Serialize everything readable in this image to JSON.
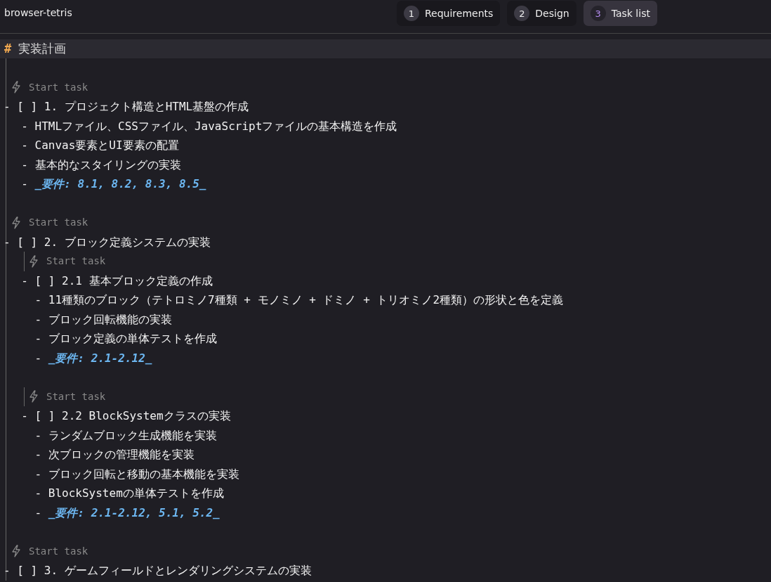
{
  "window": {
    "title": "browser-tetris"
  },
  "tabs": [
    {
      "number": "1",
      "label": "Requirements",
      "selected": false
    },
    {
      "number": "2",
      "label": "Design",
      "selected": false
    },
    {
      "number": "3",
      "label": "Task list",
      "selected": true
    }
  ],
  "heading": {
    "marker": "#",
    "text": "実装計画"
  },
  "lines": [
    {
      "kind": "blank"
    },
    {
      "kind": "codelens",
      "text": "Start task"
    },
    {
      "kind": "task",
      "text": "- [ ] 1. プロジェクト構造とHTML基盤の作成"
    },
    {
      "kind": "line",
      "text": "  - HTMLファイル、CSSファイル、JavaScriptファイルの基本構造を作成"
    },
    {
      "kind": "line",
      "text": "  - Canvas要素とUI要素の配置"
    },
    {
      "kind": "line",
      "text": "  - 基本的なスタイリングの実装"
    },
    {
      "kind": "requirement",
      "bullet": "  - ",
      "text": "_要件: 8.1, 8.2, 8.3, 8.5_"
    },
    {
      "kind": "blank"
    },
    {
      "kind": "codelens",
      "text": "Start task"
    },
    {
      "kind": "task",
      "text": "- [ ] 2. ブロック定義システムの実装"
    },
    {
      "kind": "subcodelens",
      "text": "Start task"
    },
    {
      "kind": "line",
      "text": "  - [ ] 2.1 基本ブロック定義の作成"
    },
    {
      "kind": "line",
      "text": "    - 11種類のブロック（テトロミノ7種類 + モノミノ + ドミノ + トリオミノ2種類）の形状と色を定義"
    },
    {
      "kind": "line",
      "text": "    - ブロック回転機能の実装"
    },
    {
      "kind": "line",
      "text": "    - ブロック定義の単体テストを作成"
    },
    {
      "kind": "requirement",
      "bullet": "    - ",
      "text": "_要件: 2.1-2.12_"
    },
    {
      "kind": "blank"
    },
    {
      "kind": "subcodelens",
      "text": "Start task"
    },
    {
      "kind": "line",
      "text": "  - [ ] 2.2 BlockSystemクラスの実装"
    },
    {
      "kind": "line",
      "text": "    - ランダムブロック生成機能を実装"
    },
    {
      "kind": "line",
      "text": "    - 次ブロックの管理機能を実装"
    },
    {
      "kind": "line",
      "text": "    - ブロック回転と移動の基本機能を実装"
    },
    {
      "kind": "line",
      "text": "    - BlockSystemの単体テストを作成"
    },
    {
      "kind": "requirement",
      "bullet": "    - ",
      "text": "_要件: 2.1-2.12, 5.1, 5.2_"
    },
    {
      "kind": "blank"
    },
    {
      "kind": "codelens",
      "text": "Start task"
    },
    {
      "kind": "task",
      "text": "- [ ] 3. ゲームフィールドとレンダリングシステムの実装"
    }
  ]
}
